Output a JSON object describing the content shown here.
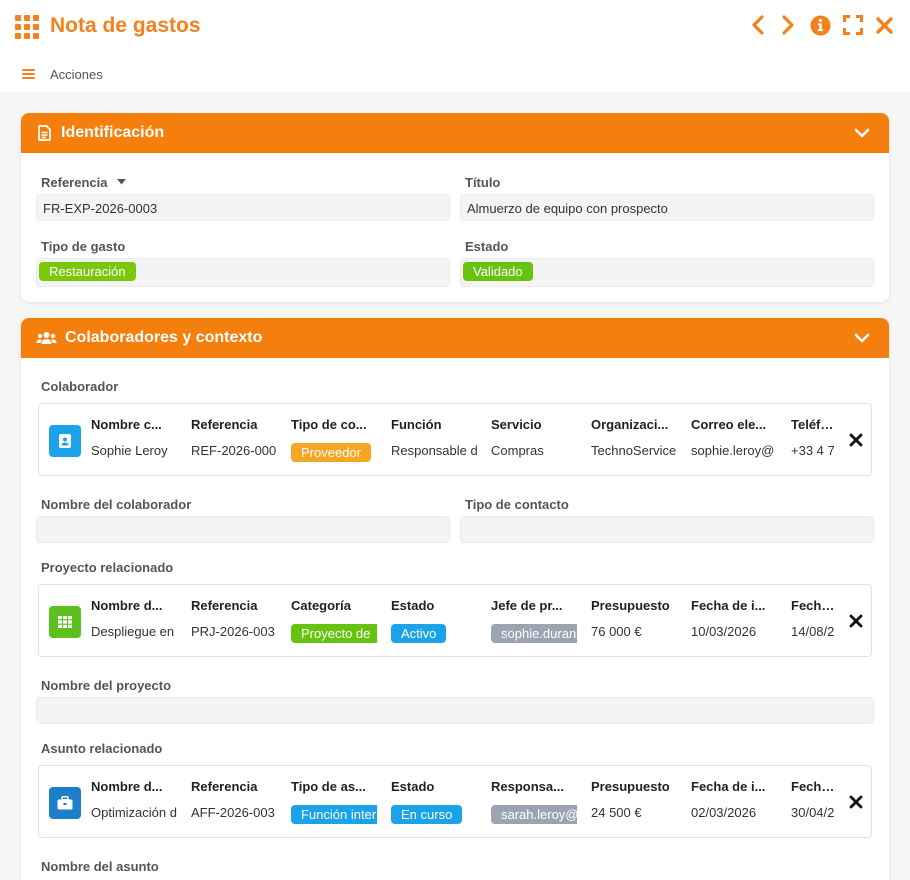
{
  "window": {
    "title": "Nota de gastos",
    "actions_label": "Acciones",
    "icons": [
      "grid-icon",
      "chevron-left-icon",
      "chevron-right-icon",
      "info-icon",
      "expand-icon",
      "close-icon",
      "hamburger-icon"
    ]
  },
  "colors": {
    "accent": "#f3811d",
    "header": "#f57f0c",
    "green": "#7ac70c",
    "orange_badge": "#f5a623",
    "blue": "#1aa3e8",
    "gray_badge": "#9aa5b1",
    "project_icon": "#5cc11e",
    "affair_icon": "#1d7fc9"
  },
  "identificacion": {
    "title": "Identificación",
    "referencia_label": "Referencia",
    "referencia_value": "FR-EXP-2026-0003",
    "titulo_label": "Título",
    "titulo_value": "Almuerzo de equipo con prospecto",
    "tipo_label": "Tipo de gasto",
    "tipo_value": "Restauración",
    "estado_label": "Estado",
    "estado_value": "Validado"
  },
  "colaboradores": {
    "title": "Colaboradores y contexto",
    "colaborador_label": "Colaborador",
    "colaborador_card": {
      "headers": [
        "Nombre c...",
        "Referencia",
        "Tipo de co...",
        "Función",
        "Servicio",
        "Organizaci...",
        "Correo ele...",
        "Teléfon"
      ],
      "values": [
        "Sophie Leroy",
        "REF-2026-000",
        "Proveedor",
        "Responsable d",
        "Compras",
        "TechnoService",
        "sophie.leroy@",
        "+33 4 7"
      ]
    },
    "nombre_colaborador_label": "Nombre del colaborador",
    "tipo_contacto_label": "Tipo de contacto",
    "proyecto_label": "Proyecto relacionado",
    "proyecto_card": {
      "headers": [
        "Nombre d...",
        "Referencia",
        "Categoría",
        "Estado",
        "Jefe de pr...",
        "Presupuesto",
        "Fecha de i...",
        "Fecha d"
      ],
      "values": [
        "Despliegue en",
        "PRJ-2026-003",
        "Proyecto de",
        "Activo",
        "sophie.duran",
        "76 000 €",
        "10/03/2026",
        "14/08/2"
      ]
    },
    "nombre_proyecto_label": "Nombre del proyecto",
    "asunto_label": "Asunto relacionado",
    "asunto_card": {
      "headers": [
        "Nombre d...",
        "Referencia",
        "Tipo de as...",
        "Estado",
        "Responsa...",
        "Presupuesto",
        "Fecha de i...",
        "Fecha d"
      ],
      "values": [
        "Optimización d",
        "AFF-2026-003",
        "Función inter",
        "En curso",
        "sarah.leroy@",
        "24 500 €",
        "02/03/2026",
        "30/04/2"
      ]
    },
    "nombre_asunto_label": "Nombre del asunto"
  }
}
